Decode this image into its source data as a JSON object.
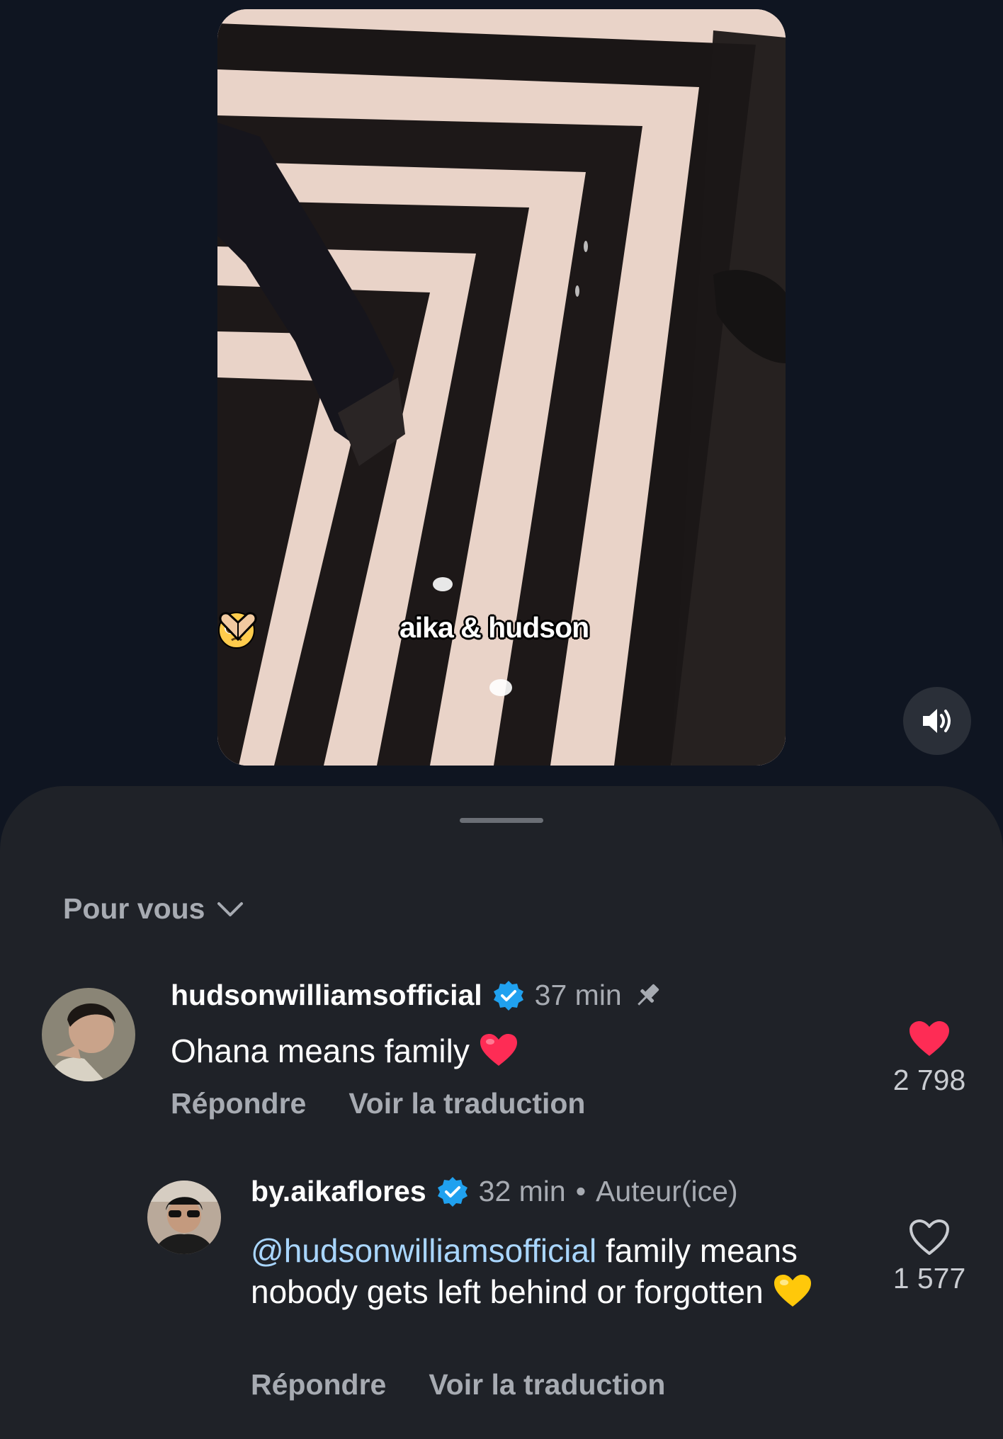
{
  "video": {
    "caption_text": "aika & hudson",
    "caption_emojis": [
      "pleading-face-emoji",
      "heart-hands-emoji"
    ],
    "sound_icon": "speaker-on-icon"
  },
  "comments_sheet": {
    "filter_label": "Pour vous",
    "filter_icon": "chevron-down-icon",
    "comments": [
      {
        "username": "hudsonwilliamsofficial",
        "verified": true,
        "time": "37 min",
        "pinned": true,
        "text": "Ohana means family",
        "text_emoji": "red-heart-emoji",
        "reply_label": "Répondre",
        "translate_label": "Voir la traduction",
        "liked": true,
        "like_count": "2 798"
      },
      {
        "username": "by.aikaflores",
        "verified": true,
        "time": "32 min",
        "author_tag": "Auteur(ice)",
        "mention": "@hudsonwilliamsofficial",
        "text": " family means nobody gets left behind or forgotten",
        "text_emoji": "yellow-heart-emoji",
        "reply_label": "Répondre",
        "translate_label": "Voir la traduction",
        "liked": false,
        "like_count": "1 577"
      }
    ]
  },
  "colors": {
    "background": "#0f1521",
    "sheet": "#1f2228",
    "secondary_text": "#a7abb2",
    "mention": "#a9d6ff",
    "like_red": "#fe2c55",
    "verified_blue": "#20a1ef"
  }
}
